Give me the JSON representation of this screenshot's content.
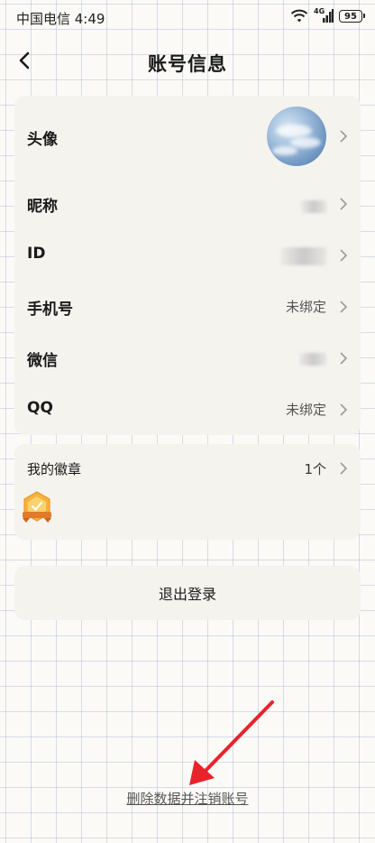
{
  "status_bar": {
    "carrier_time": "中国电信 4:49",
    "network": "4G",
    "battery": "95"
  },
  "header": {
    "title": "账号信息",
    "back_icon": "back-arrow-icon"
  },
  "account_rows": [
    {
      "label": "头像",
      "value": ""
    },
    {
      "label": "昵称",
      "value": ""
    },
    {
      "label": "ID",
      "value": ""
    },
    {
      "label": "手机号",
      "value": "未绑定"
    },
    {
      "label": "微信",
      "value": ""
    },
    {
      "label": "QQ",
      "value": "未绑定"
    }
  ],
  "badges": {
    "title": "我的徽章",
    "count": "1个"
  },
  "logout": {
    "label": "退出登录"
  },
  "delete_account": {
    "label": "删除数据并注销账号"
  },
  "annotation_color": "#e8232c"
}
